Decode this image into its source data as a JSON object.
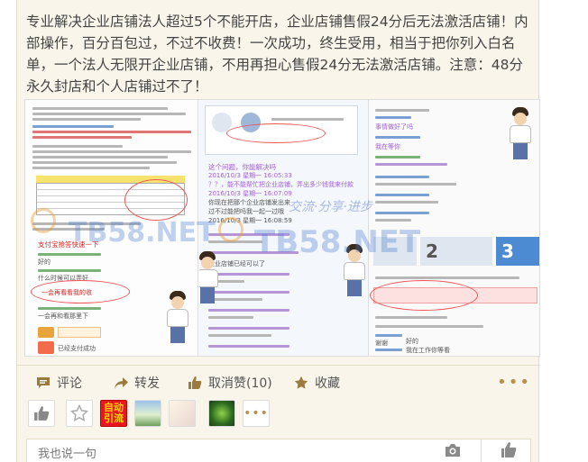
{
  "post": {
    "text": "专业解决企业店铺法人超过5个不能开店，企业店铺售假24分后无法激活店铺！内部操作，百分百包过，不过不收费！一次成功，终生受用，相当于把你列入白名单，一个法人无限开企业店铺，不用再担心售假24分无法激活店铺。注意：48分永久封店和个人店铺过不了！"
  },
  "collage": {
    "panel1": {
      "captions": [
        "支付宝抢答快速一下",
        "好的",
        "什么时候可以弄好",
        "一会再看看我的收",
        "一会再和看那里下",
        "已经支付成功"
      ]
    },
    "panel2": {
      "captions": [
        "这个问题，你能解决吗",
        "？？，能不能帮忙把企业店铺，弄出多少钱我来付款",
        "你现在把那个企业店铺发出来",
        "过不过能把吗我一起一过哦",
        "企业店铺已经可以了"
      ],
      "dates": [
        "2016/10/3 星期一 16:05:33",
        "2016/10/3 星期一 16:07:09",
        "2016/10/3 星期一 16:08:59"
      ]
    },
    "panel3": {
      "captions": [
        "事情做好了吗",
        "我在等你",
        "谢谢",
        "好的",
        "我在工作你等看"
      ],
      "step_numbers": [
        "2",
        "3"
      ]
    },
    "watermark": {
      "brand": "TB58.NET",
      "slogan": "交流·分享·进步"
    }
  },
  "actions": {
    "comment": "评论",
    "share": "转发",
    "unlike": "取消赞(10)",
    "favorite": "收藏"
  },
  "likers": {
    "badge_text": "自动引流"
  },
  "comment_box": {
    "placeholder": "我也说一句"
  }
}
